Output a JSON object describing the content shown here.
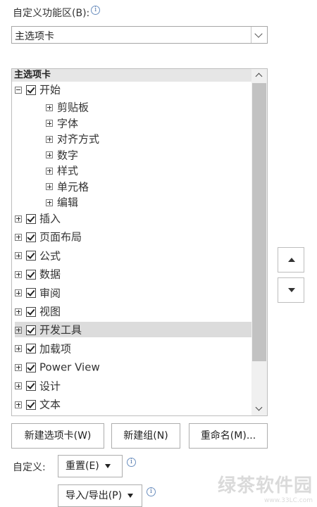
{
  "customize_label": "自定义功能区(B):",
  "tab_select": {
    "value": "主选项卡"
  },
  "tree": {
    "header": "主选项卡",
    "root": {
      "label": "开始",
      "checked": true
    },
    "groups": [
      "剪贴板",
      "字体",
      "对齐方式",
      "数字",
      "样式",
      "单元格",
      "编辑"
    ],
    "tabs": [
      {
        "label": "插入",
        "checked": true
      },
      {
        "label": "页面布局",
        "checked": true
      },
      {
        "label": "公式",
        "checked": true
      },
      {
        "label": "数据",
        "checked": true
      },
      {
        "label": "审阅",
        "checked": true
      },
      {
        "label": "视图",
        "checked": true
      },
      {
        "label": "开发工具",
        "checked": true,
        "selected": true
      },
      {
        "label": "加载项",
        "checked": true
      },
      {
        "label": "Power View",
        "checked": true
      },
      {
        "label": "设计",
        "checked": true
      },
      {
        "label": "文本",
        "checked": true
      }
    ]
  },
  "buttons": {
    "new_tab": "新建选项卡(W)",
    "new_group": "新建组(N)",
    "rename": "重命名(M)..."
  },
  "customize": {
    "label": "自定义:",
    "reset": "重置(E)",
    "import_export": "导入/导出(P)"
  },
  "watermark": {
    "text": "绿茶软件园",
    "url": "www.33LC.com"
  }
}
